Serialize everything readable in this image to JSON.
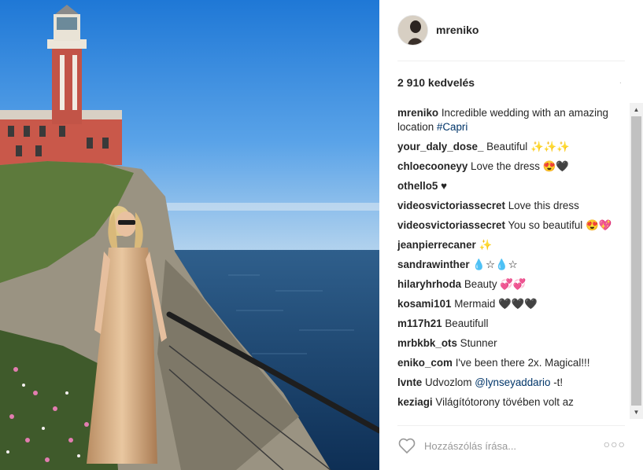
{
  "post": {
    "username": "mreniko",
    "likes": "2 910 kedvelés",
    "likes_dot": ".",
    "comments": [
      {
        "user": "mreniko",
        "text": "Incredible wedding with an amazing location ",
        "tag": "#Capri"
      },
      {
        "user": "your_daly_dose_",
        "text": "Beautiful ✨✨✨"
      },
      {
        "user": "chloecooneyy",
        "text": "Love the dress 😍🖤"
      },
      {
        "user": "othello5",
        "text": "♥"
      },
      {
        "user": "videosvictoriassecret",
        "text": "Love this dress"
      },
      {
        "user": "videosvictoriassecret",
        "text": "You so beautiful 😍💖"
      },
      {
        "user": "jeanpierrecaner",
        "text": "✨"
      },
      {
        "user": "sandrawinther",
        "text": "💧☆💧☆"
      },
      {
        "user": "hilaryhrhoda",
        "text": "Beauty 💞💞"
      },
      {
        "user": "kosami101",
        "text": "Mermaid 🖤🖤🖤"
      },
      {
        "user": "m117h21",
        "text": "Beautifull"
      },
      {
        "user": "mrbkbk_ots",
        "text": "Stunner"
      },
      {
        "user": "eniko_com",
        "text": "I've been there 2x. Magical!!!"
      },
      {
        "user": "lvnte",
        "text": "Udvozlom ",
        "tag": "@lynseyaddario",
        "after": " -t!"
      },
      {
        "user": "keziagi",
        "text": "Világítótorony tövében volt az"
      }
    ]
  },
  "footer": {
    "placeholder": "Hozzászólás írása...",
    "more_label": "○○○"
  },
  "scrollbar": {
    "up": "▲",
    "down": "▼"
  },
  "icons": {
    "like": "heart-outline-icon",
    "more": "more-options-icon"
  }
}
